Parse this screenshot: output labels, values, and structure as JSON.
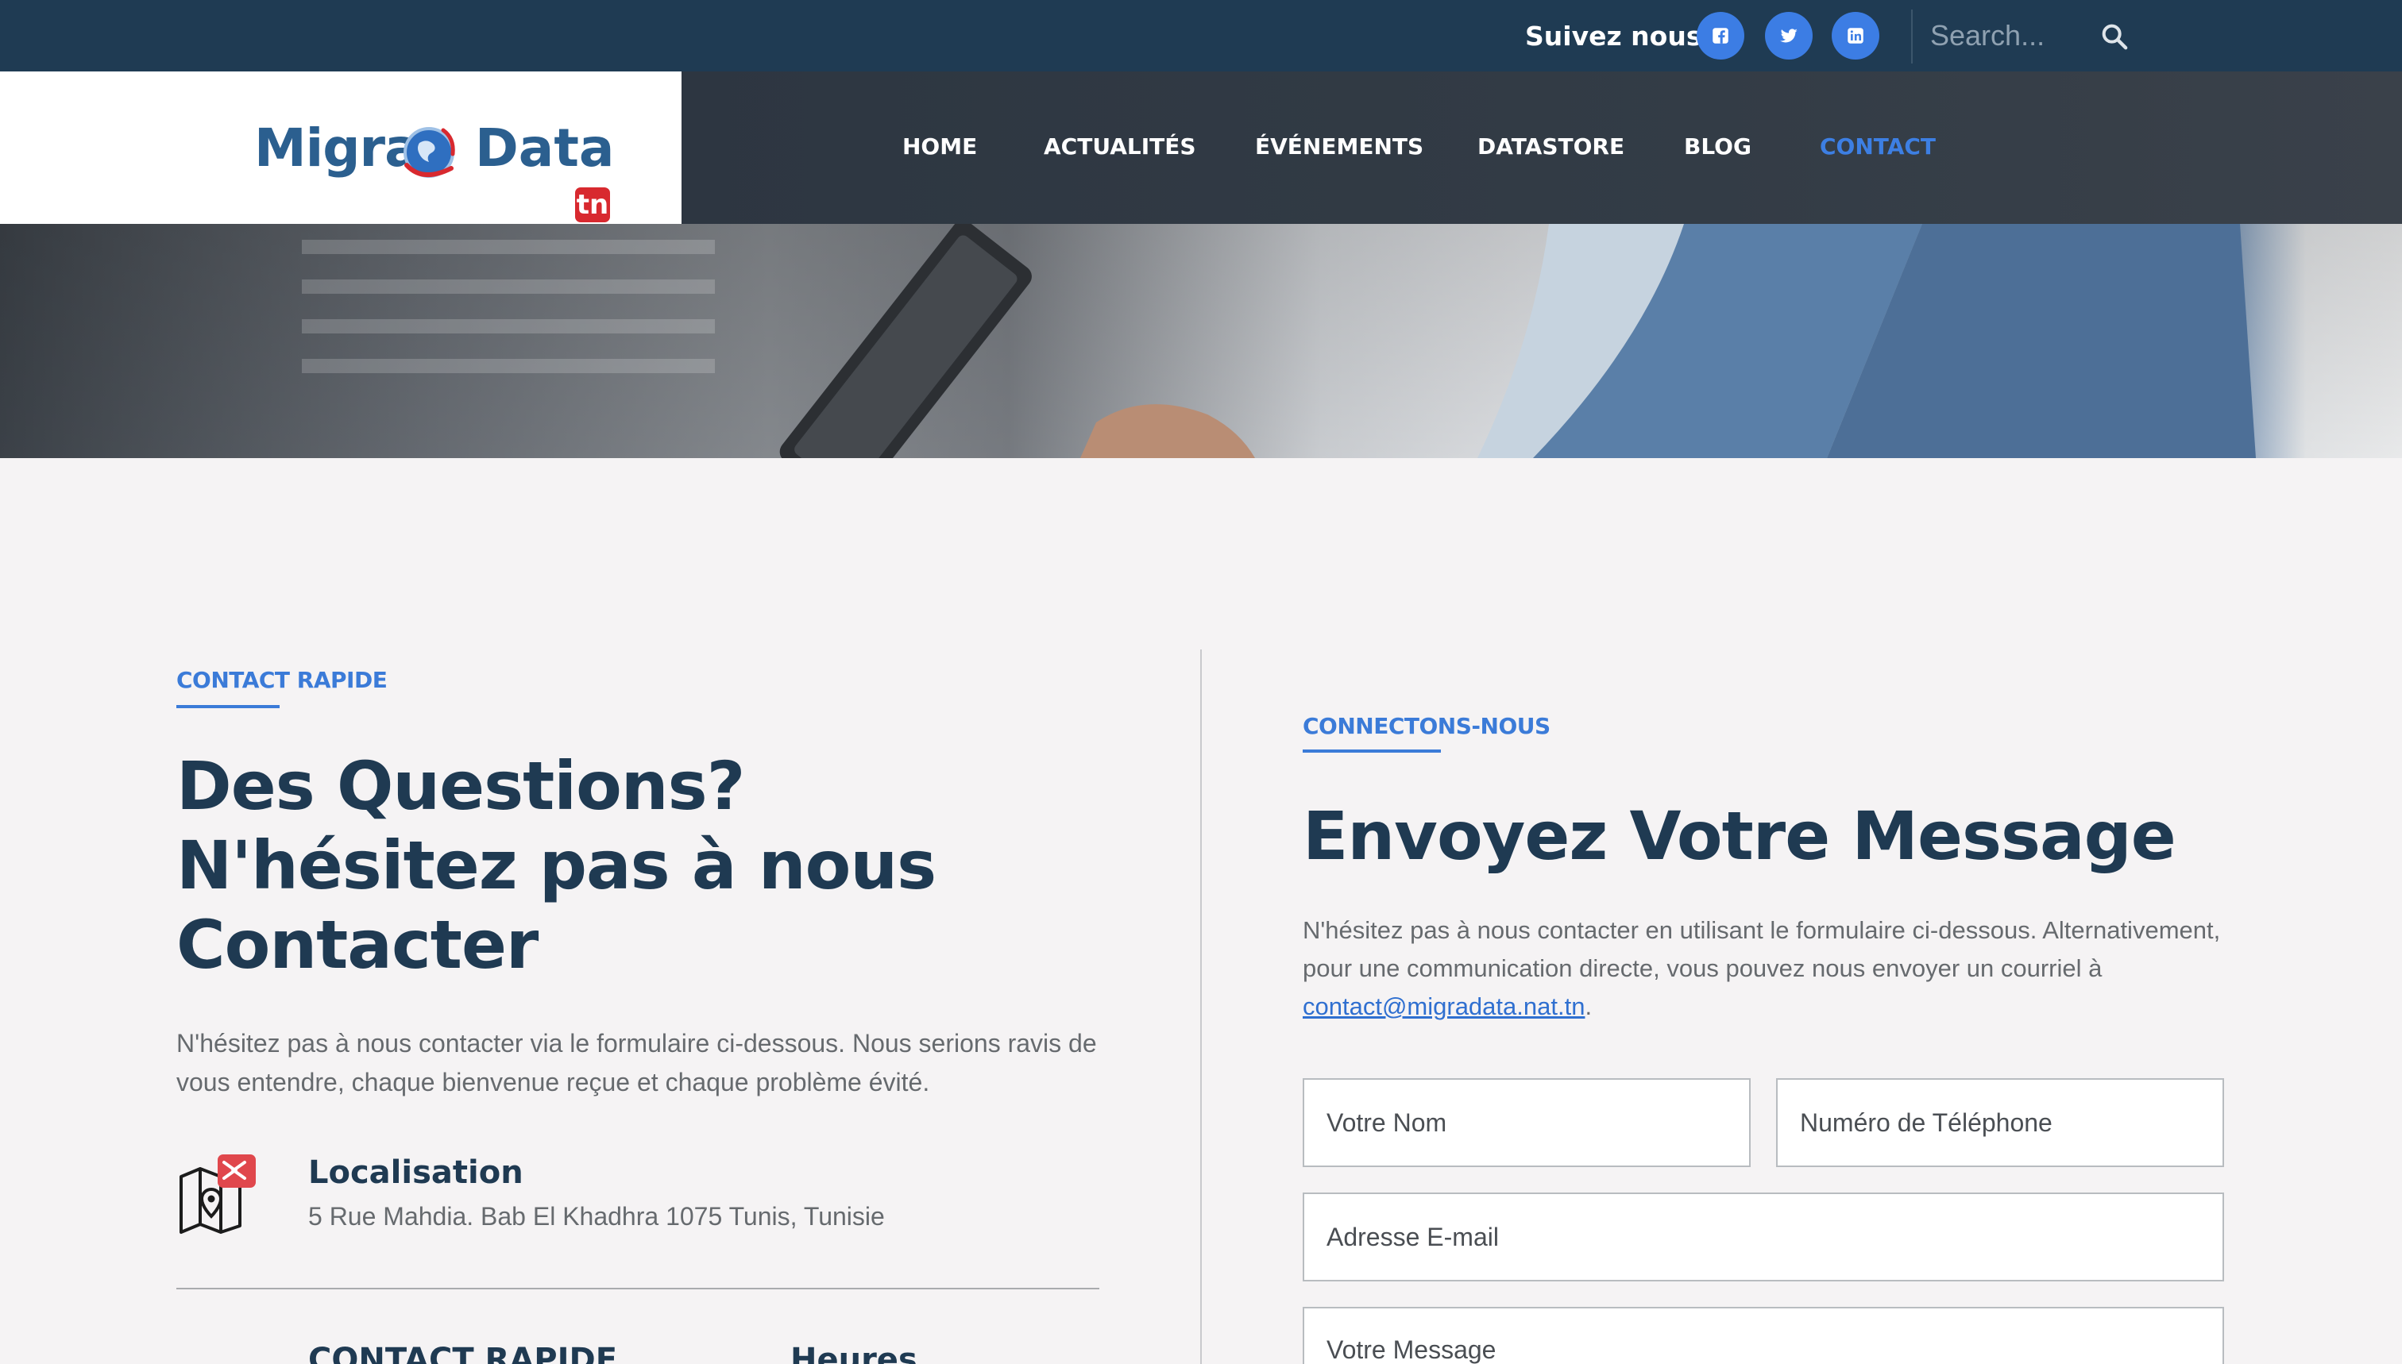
{
  "topbar": {
    "follow_label": "Suivez nous",
    "social": [
      "facebook-icon",
      "twitter-icon",
      "linkedin-icon"
    ],
    "search_placeholder": "Search..."
  },
  "logo": {
    "word1": "Migra",
    "word2": "Data",
    "badge": "tn"
  },
  "nav": {
    "items": [
      {
        "label": "HOME"
      },
      {
        "label": "ACTUALITÉS"
      },
      {
        "label": "ÉVÉNEMENTS"
      },
      {
        "label": "DATASTORE"
      },
      {
        "label": "BLOG"
      },
      {
        "label": "CONTACT",
        "active": true
      }
    ]
  },
  "left": {
    "eyebrow": "CONTACT RAPIDE",
    "heading_line1": "Des Questions?",
    "heading_line2": "N'hésitez pas à nous",
    "heading_line3": "Contacter",
    "paragraph": "N'hésitez pas à nous contacter via le formulaire ci-dessous. Nous serions ravis de vous entendre, chaque bienvenue reçue et chaque problème évité.",
    "location": {
      "title": "Localisation",
      "address": "5 Rue Mahdia. Bab El Khadhra 1075 Tunis, Tunisie"
    },
    "sub_a": "CONTACT RAPIDE",
    "sub_b": "Heures"
  },
  "right": {
    "eyebrow": "CONNECTONS-NOUS",
    "heading": "Envoyez Votre Message",
    "paragraph_before": "N'hésitez pas à nous contacter en utilisant le formulaire ci-dessous. Alternativement, pour une communication directe, vous pouvez nous envoyer un courriel à ",
    "email": "contact@migradata.nat.tn",
    "paragraph_after": ".",
    "form": {
      "name_placeholder": "Votre Nom",
      "phone_placeholder": "Numéro de Téléphone",
      "email_placeholder": "Adresse E-mail",
      "message_placeholder": "Votre Message"
    }
  },
  "colors": {
    "topbar": "#1f3b53",
    "accent": "#3b7bd8",
    "heading": "#1f3a52",
    "badge_red": "#d8292f"
  }
}
